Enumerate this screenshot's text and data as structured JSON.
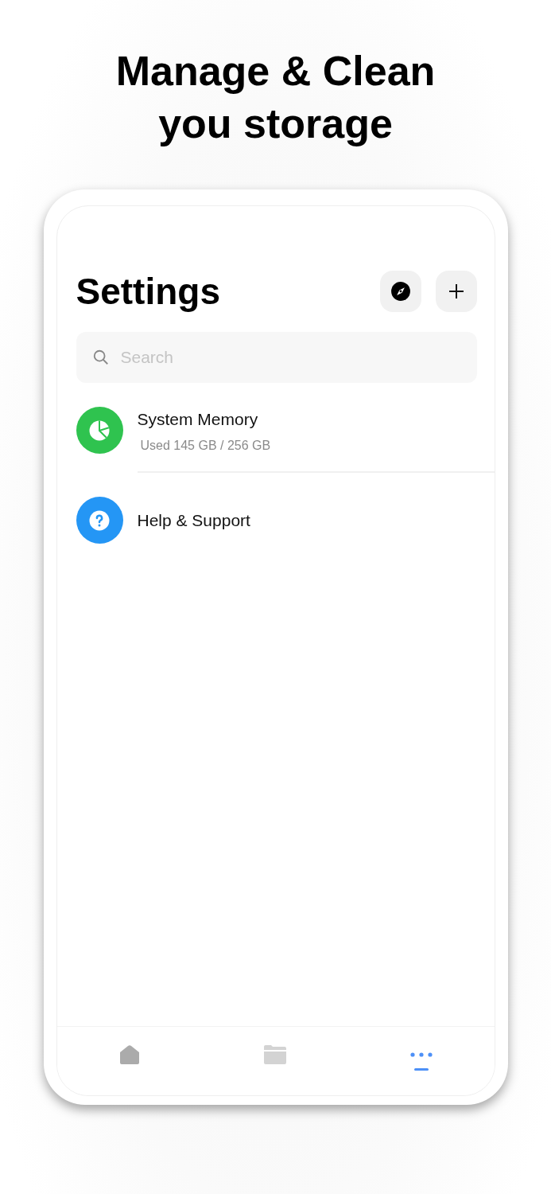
{
  "headline": [
    "Manage & Clean",
    "you storage"
  ],
  "screen": {
    "title": "Settings",
    "search": {
      "placeholder": "Search"
    },
    "items": [
      {
        "kind": "memory",
        "title": "System Memory",
        "subtitle": "Used 145 GB / 256 GB",
        "color": "#2fc34f"
      },
      {
        "kind": "help",
        "title": "Help & Support",
        "color": "#2496f5"
      }
    ],
    "tabs": [
      {
        "kind": "home",
        "selected": false
      },
      {
        "kind": "folder",
        "selected": false
      },
      {
        "kind": "more",
        "selected": true
      }
    ]
  }
}
